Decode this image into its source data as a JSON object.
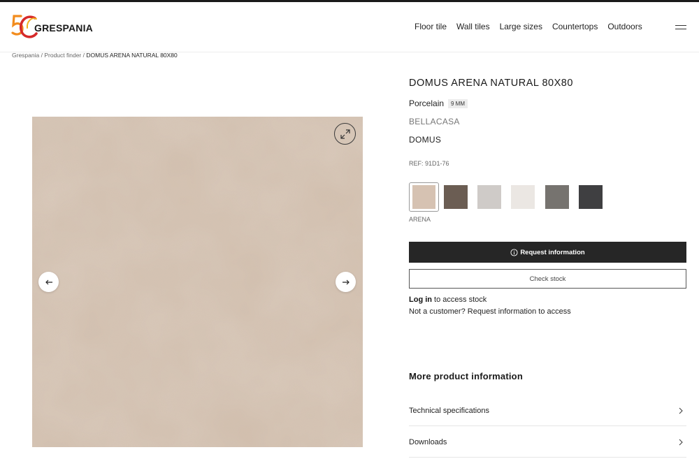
{
  "brand": {
    "logo_text": "GRESPANIA",
    "logo_number": "50"
  },
  "nav": {
    "items": [
      {
        "label": "Floor tile"
      },
      {
        "label": "Wall tiles"
      },
      {
        "label": "Large sizes"
      },
      {
        "label": "Countertops"
      },
      {
        "label": "Outdoors"
      }
    ],
    "menu_icon": "hamburger-icon"
  },
  "breadcrumb": {
    "items": [
      "Grespania",
      "Product finder"
    ],
    "separator": "/",
    "current": "DOMUS ARENA NATURAL 80X80"
  },
  "gallery": {
    "zoom_icon": "expand-icon",
    "prev_icon": "arrow-left-icon",
    "next_icon": "arrow-right-icon",
    "tile_color": "#d2bfae"
  },
  "product": {
    "title": "DOMUS ARENA NATURAL 80X80",
    "material": "Porcelain",
    "thickness_badge": "9 MM",
    "collection": "BELLACASA",
    "series": "DOMUS",
    "ref": "REF: 91D1-76",
    "swatches": [
      {
        "name": "ARENA",
        "color": "#d6c2b2",
        "selected": true
      },
      {
        "color": "#6b5d53"
      },
      {
        "color": "#cfcbc8"
      },
      {
        "color": "#ebe7e3"
      },
      {
        "color": "#76736f"
      },
      {
        "color": "#3f3f41"
      }
    ],
    "selected_color_name": "ARENA"
  },
  "actions": {
    "request_info_label": "Request information",
    "request_info_icon": "info-icon",
    "check_stock_label": "Check stock",
    "login_link": "Log in",
    "login_suffix": " to access stock",
    "customer_prefix": "Not a customer? ",
    "customer_link": "Request information",
    "customer_suffix": " to access"
  },
  "more_info": {
    "title": "More product information",
    "items": [
      {
        "label": "Technical specifications",
        "icon": "chevron-right-icon"
      },
      {
        "label": "Downloads",
        "icon": "chevron-right-icon"
      }
    ]
  },
  "colors": {
    "primary_button": "#262626",
    "logo_orange": "#f28c1e",
    "logo_red": "#d62a2a"
  }
}
